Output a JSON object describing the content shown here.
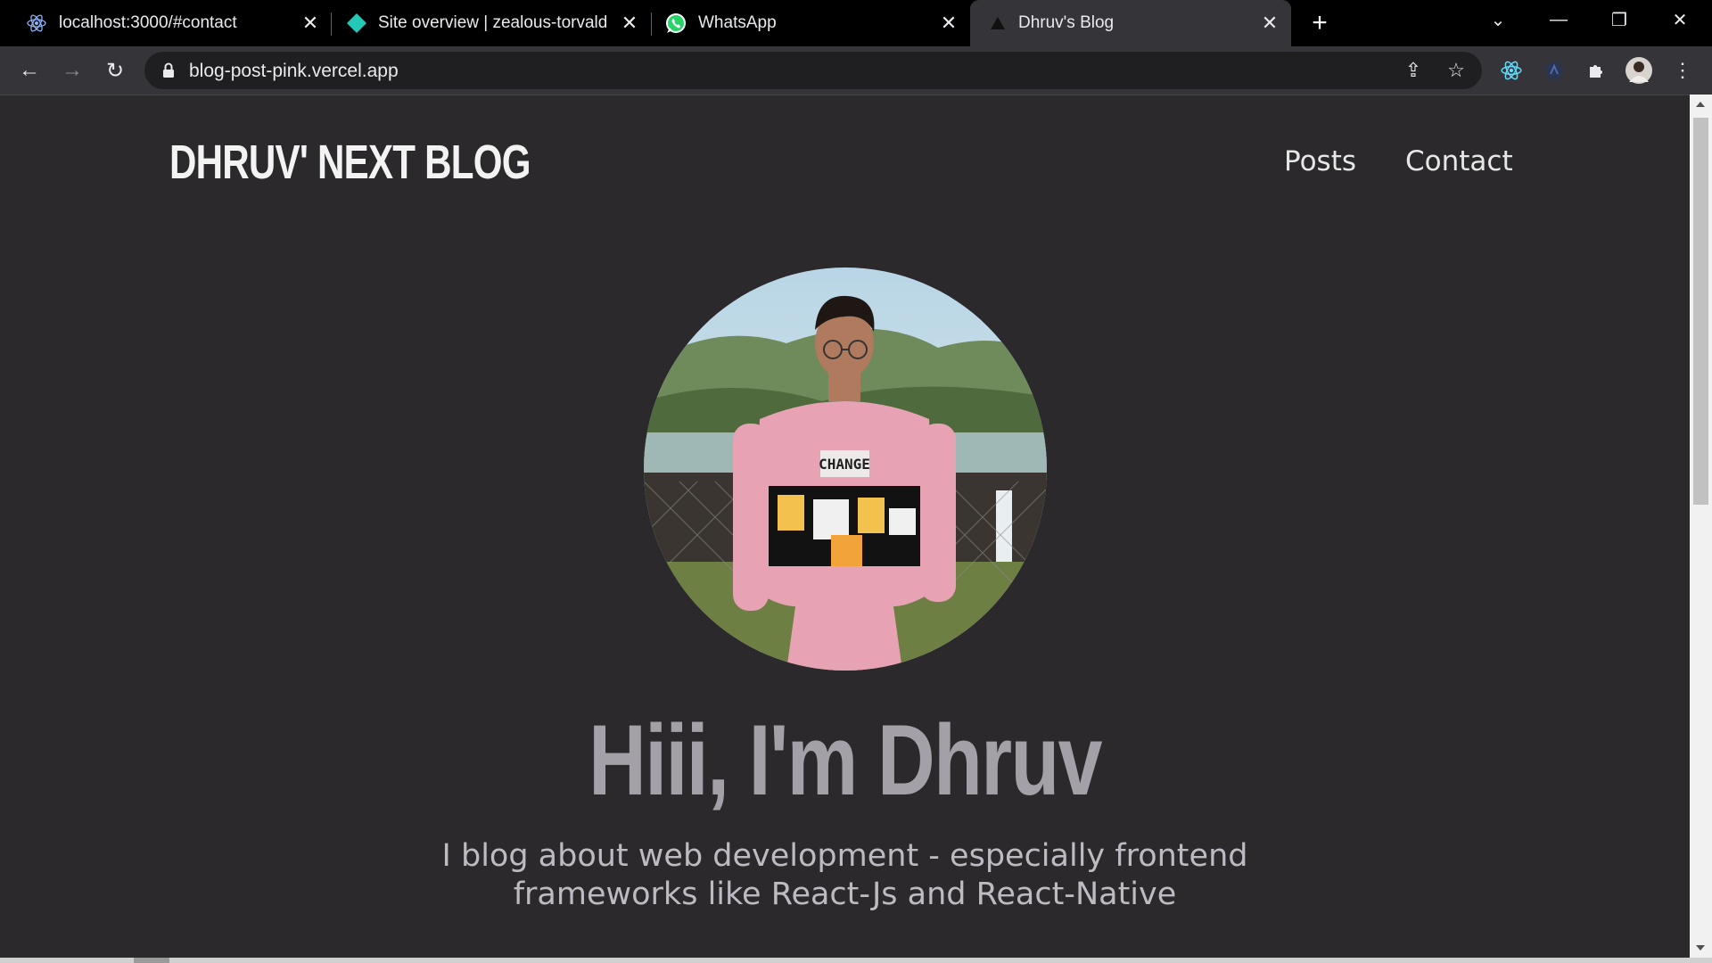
{
  "browser": {
    "tabs": [
      {
        "title": "localhost:3000/#contact",
        "favicon": "react-icon"
      },
      {
        "title": "Site overview | zealous-torvalds-",
        "favicon": "netlify-icon"
      },
      {
        "title": "WhatsApp",
        "favicon": "whatsapp-icon"
      },
      {
        "title": "Dhruv's Blog",
        "favicon": "vercel-icon",
        "active": true
      }
    ],
    "url": "blog-post-pink.vercel.app",
    "colors": {
      "tabbar": "#000000",
      "toolbar": "#353438",
      "page_bg": "#2b292c"
    }
  },
  "site": {
    "brand": "DHRUV' NEXT BLOG",
    "nav": [
      {
        "label": "Posts"
      },
      {
        "label": "Contact"
      }
    ],
    "hero": {
      "title": "Hiii, I'm Dhruv",
      "subtitle_line1": "I blog about web development - especially frontend",
      "subtitle_line2": "frameworks like React-Js and React-Native",
      "avatar_alt": "profile-photo"
    }
  }
}
